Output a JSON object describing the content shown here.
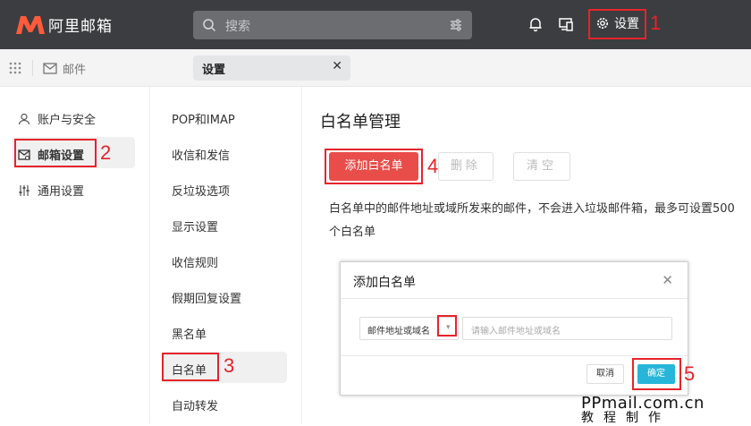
{
  "topbar": {
    "brand": "阿里邮箱",
    "search_placeholder": "搜索",
    "settings_label": "设置"
  },
  "tabs": {
    "mail_label": "邮件",
    "active_label": "设置",
    "close_glyph": "✕"
  },
  "sidebar": {
    "items": [
      {
        "label": "账户与安全",
        "icon": "user-icon"
      },
      {
        "label": "邮箱设置",
        "icon": "mail-settings-icon"
      },
      {
        "label": "通用设置",
        "icon": "sliders-icon"
      }
    ]
  },
  "subnav": {
    "items": [
      "POP和IMAP",
      "收信和发信",
      "反垃圾选项",
      "显示设置",
      "收信规则",
      "假期回复设置",
      "黑名单",
      "白名单",
      "自动转发"
    ]
  },
  "main": {
    "title": "白名单管理",
    "add_button": "添加白名单",
    "delete_button": "删除",
    "clear_button": "清空",
    "description": "白名单中的邮件地址或域所发来的邮件，不会进入垃圾邮件箱，最多可设置500个白名单"
  },
  "dialog": {
    "title": "添加白名单",
    "close_glyph": "✕",
    "select_value": "邮件地址或域名",
    "input_placeholder": "请输入邮件地址或域名",
    "cancel_button": "取消",
    "ok_button": "确定"
  },
  "annotations": {
    "n1": "1",
    "n2": "2",
    "n3": "3",
    "n4": "4",
    "n5": "5",
    "color": "#e5242b"
  },
  "watermark": {
    "line1": "PPmail.com.cn",
    "line2": "教程制作"
  },
  "colors": {
    "topbar": "#3b3d40",
    "accent_red": "#e84d4a",
    "confirm_blue": "#27b6d9"
  }
}
